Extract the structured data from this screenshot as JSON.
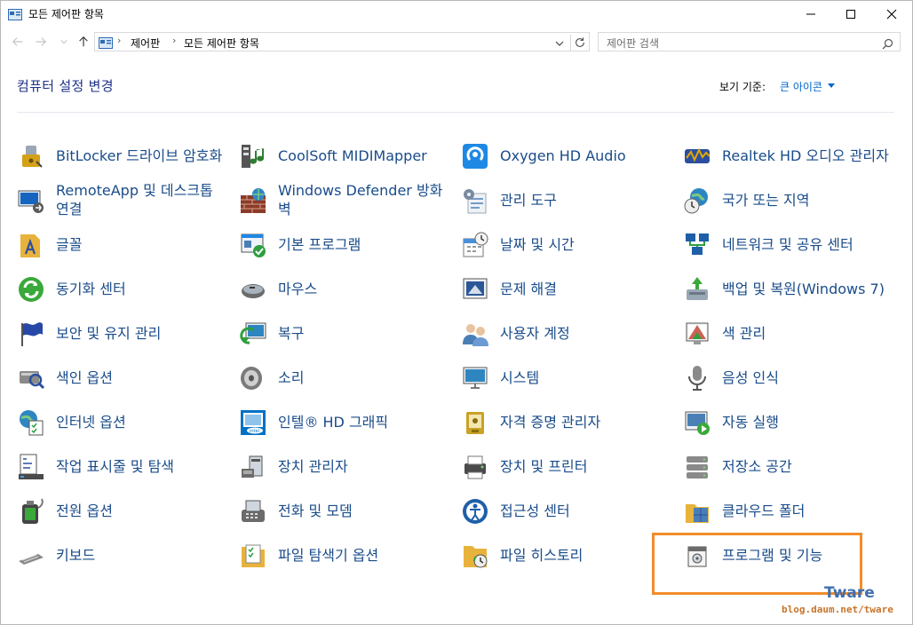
{
  "window": {
    "title": "모든 제어판 항목",
    "minimize": "minimize",
    "maximize": "maximize",
    "close": "close"
  },
  "address": {
    "segments": [
      "제어판",
      "모든 제어판 항목"
    ],
    "search_placeholder": "제어판 검색"
  },
  "header": {
    "title": "컴퓨터 설정 변경",
    "view_by_label": "보기 기준:",
    "view_by_value": "큰 아이콘"
  },
  "items": [
    {
      "label": "BitLocker 드라이브 암호화",
      "icon": "bitlocker-icon",
      "color": "#d4a017"
    },
    {
      "label": "CoolSoft MIDIMapper",
      "icon": "midimapper-icon",
      "color": "#2e7d32"
    },
    {
      "label": "Oxygen HD Audio",
      "icon": "audio-icon",
      "color": "#1e88e5"
    },
    {
      "label": "Realtek HD 오디오 관리자",
      "icon": "realtek-icon",
      "color": "#e6a700"
    },
    {
      "label": "RemoteApp 및 데스크톱 연결",
      "icon": "remoteapp-icon",
      "color": "#1565c0"
    },
    {
      "label": "Windows Defender 방화벽",
      "icon": "firewall-icon",
      "color": "#8b3a2a"
    },
    {
      "label": "관리 도구",
      "icon": "admin-tools-icon",
      "color": "#7a8aa0"
    },
    {
      "label": "국가 또는 지역",
      "icon": "region-icon",
      "color": "#2e86c1"
    },
    {
      "label": "글꼴",
      "icon": "fonts-icon",
      "color": "#e8b33c"
    },
    {
      "label": "기본 프로그램",
      "icon": "default-programs-icon",
      "color": "#1e88e5"
    },
    {
      "label": "날짜 및 시간",
      "icon": "datetime-icon",
      "color": "#4a90d9"
    },
    {
      "label": "네트워크 및 공유 센터",
      "icon": "network-icon",
      "color": "#1f5fa8"
    },
    {
      "label": "동기화 센터",
      "icon": "sync-icon",
      "color": "#3aa83a"
    },
    {
      "label": "마우스",
      "icon": "mouse-icon",
      "color": "#6b6b6b"
    },
    {
      "label": "문제 해결",
      "icon": "troubleshoot-icon",
      "color": "#2b5797"
    },
    {
      "label": "백업 및 복원(Windows 7)",
      "icon": "backup-icon",
      "color": "#3aa83a"
    },
    {
      "label": "보안 및 유지 관리",
      "icon": "flag-icon",
      "color": "#2848a8"
    },
    {
      "label": "복구",
      "icon": "recovery-icon",
      "color": "#2e86c1"
    },
    {
      "label": "사용자 계정",
      "icon": "users-icon",
      "color": "#4a7fb5"
    },
    {
      "label": "색 관리",
      "icon": "color-mgmt-icon",
      "color": "#c0392b"
    },
    {
      "label": "색인 옵션",
      "icon": "indexing-icon",
      "color": "#8a8a8a"
    },
    {
      "label": "소리",
      "icon": "speaker-icon",
      "color": "#7a7a7a"
    },
    {
      "label": "시스템",
      "icon": "system-icon",
      "color": "#2e86c1"
    },
    {
      "label": "음성 인식",
      "icon": "microphone-icon",
      "color": "#8a8a8a"
    },
    {
      "label": "인터넷 옵션",
      "icon": "internet-options-icon",
      "color": "#2e86c1"
    },
    {
      "label": "인텔® HD 그래픽",
      "icon": "intel-icon",
      "color": "#0071c5"
    },
    {
      "label": "자격 증명 관리자",
      "icon": "credential-icon",
      "color": "#c9a227"
    },
    {
      "label": "자동 실행",
      "icon": "autoplay-icon",
      "color": "#3aa83a"
    },
    {
      "label": "작업 표시줄 및 탐색",
      "icon": "taskbar-icon",
      "color": "#4a4a4a"
    },
    {
      "label": "장치 관리자",
      "icon": "device-manager-icon",
      "color": "#6b6b6b"
    },
    {
      "label": "장치 및 프린터",
      "icon": "printer-icon",
      "color": "#4a4a4a"
    },
    {
      "label": "저장소 공간",
      "icon": "storage-icon",
      "color": "#8a8a8a"
    },
    {
      "label": "전원 옵션",
      "icon": "power-icon",
      "color": "#3aa83a"
    },
    {
      "label": "전화 및 모뎀",
      "icon": "phone-icon",
      "color": "#6b6b6b"
    },
    {
      "label": "접근성 센터",
      "icon": "accessibility-icon",
      "color": "#1f5fa8"
    },
    {
      "label": "클라우드 폴더",
      "icon": "cloud-folder-icon",
      "color": "#e8b33c"
    },
    {
      "label": "키보드",
      "icon": "keyboard-icon",
      "color": "#8a8a8a"
    },
    {
      "label": "파일 탐색기 옵션",
      "icon": "folder-options-icon",
      "color": "#e8b33c"
    },
    {
      "label": "파일 히스토리",
      "icon": "file-history-icon",
      "color": "#e8b33c"
    },
    {
      "label": "프로그램 및 기능",
      "icon": "programs-features-icon",
      "color": "#6b6b6b"
    }
  ],
  "watermark": {
    "brand": "Tware",
    "url": "blog.daum.net/tware"
  },
  "colors": {
    "link": "#1a4c8a",
    "heading": "#1e3287",
    "highlight": "#f28c2a"
  }
}
